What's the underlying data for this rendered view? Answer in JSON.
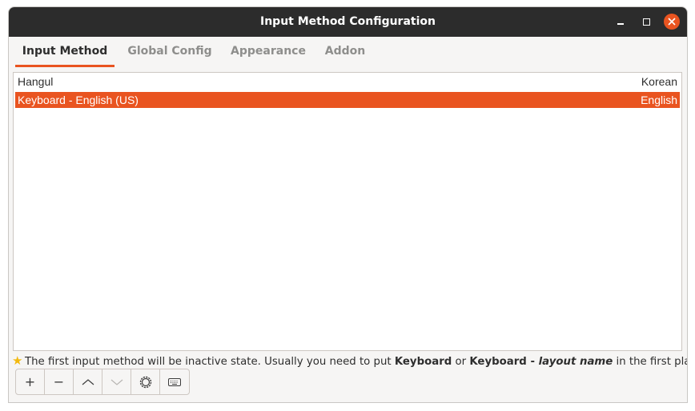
{
  "window": {
    "title": "Input Method Configuration",
    "accent_color": "#e95420",
    "controls": [
      "minimize-icon",
      "maximize-icon",
      "close-icon"
    ]
  },
  "tabs": [
    {
      "label": "Input Method",
      "active": true
    },
    {
      "label": "Global Config",
      "active": false
    },
    {
      "label": "Appearance",
      "active": false
    },
    {
      "label": "Addon",
      "active": false
    }
  ],
  "input_methods": [
    {
      "name": "Hangul",
      "language": "Korean",
      "selected": false
    },
    {
      "name": "Keyboard - English (US)",
      "language": "English",
      "selected": true
    }
  ],
  "hint": {
    "icon": "star-icon",
    "text_1": "The first input method will be inactive state. Usually you need to put ",
    "bold_1": "Keyboard",
    "text_2": " or ",
    "bold_2": "Keyboard - ",
    "bold_italic": "layout name",
    "text_3": " in the first place."
  },
  "toolbar": {
    "add": "+",
    "remove": "−",
    "buttons": [
      "plus-icon",
      "minus-icon",
      "move-up-icon",
      "move-down-icon",
      "settings-icon",
      "keyboard-icon"
    ]
  }
}
